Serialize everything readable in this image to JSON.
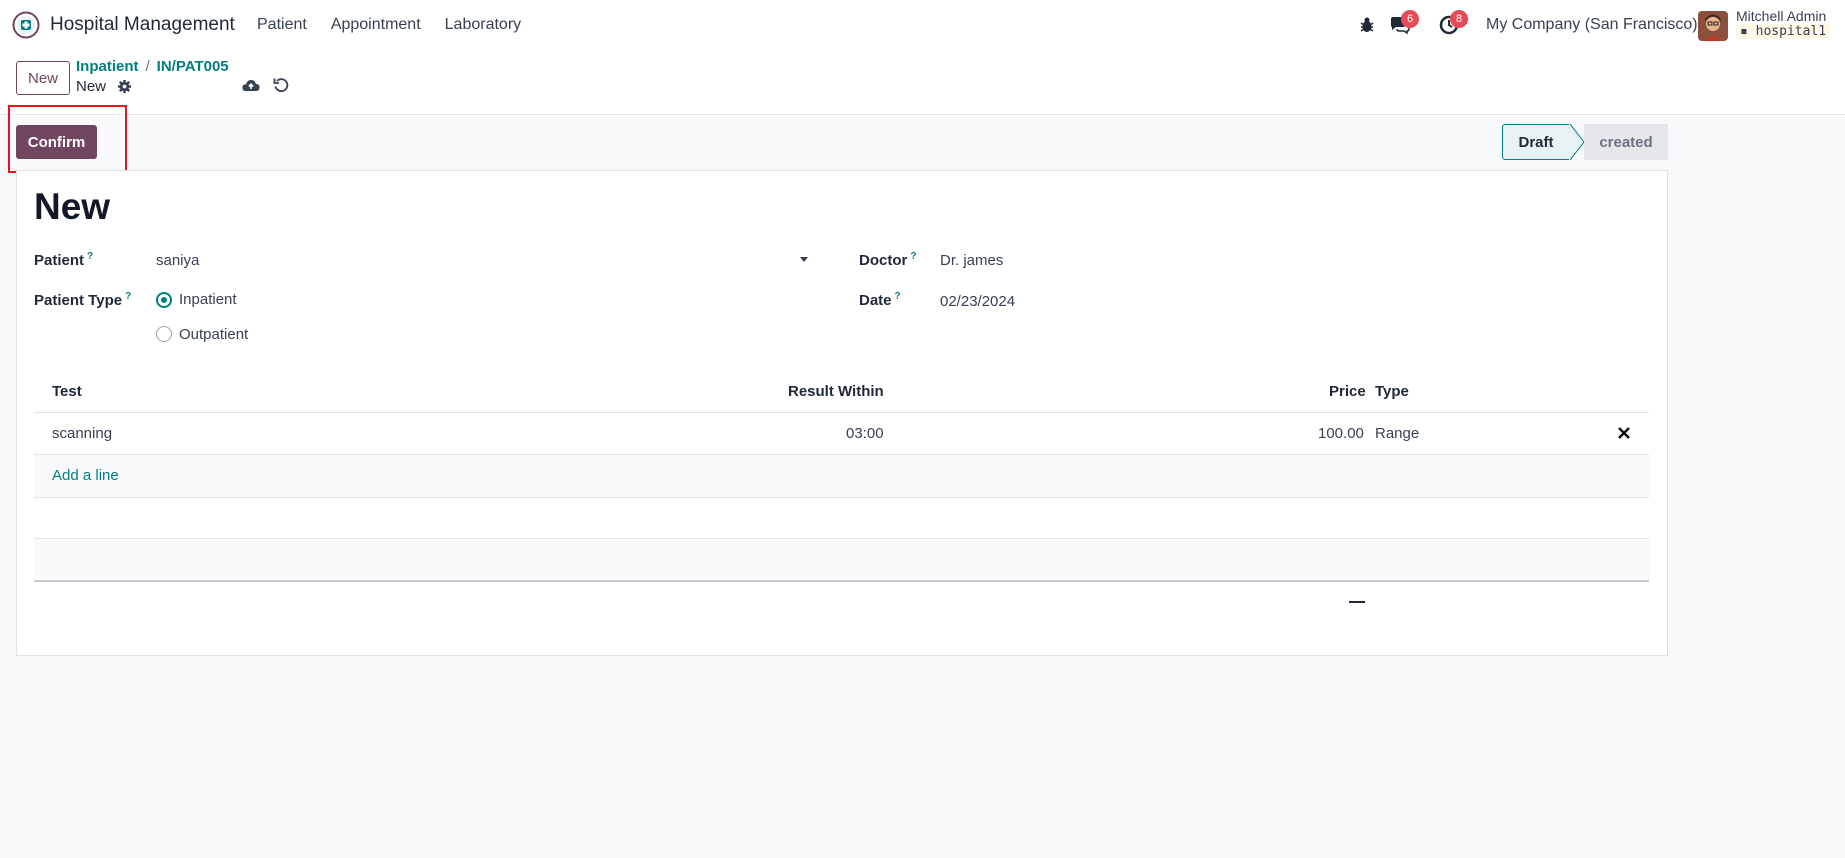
{
  "navbar": {
    "app_name": "Hospital Management",
    "menu": [
      "Patient",
      "Appointment",
      "Laboratory"
    ],
    "messages_count": "6",
    "activities_count": "8",
    "company": "My Company (San Francisco)",
    "user_name": "Mitchell Admin",
    "db_name": "hospital1"
  },
  "control": {
    "new_label": "New",
    "breadcrumb": [
      "Inpatient",
      "IN/PAT005"
    ],
    "current": "New"
  },
  "statusbar": {
    "confirm_label": "Confirm",
    "stages": [
      "Draft",
      "created"
    ],
    "active_stage": "Draft"
  },
  "form": {
    "title": "New",
    "patient_label": "Patient",
    "patient_value": "saniya",
    "patient_type_label": "Patient Type",
    "patient_type_options": [
      "Inpatient",
      "Outpatient"
    ],
    "patient_type_selected": "Inpatient",
    "doctor_label": "Doctor",
    "doctor_value": "Dr. james",
    "date_label": "Date",
    "date_value": "02/23/2024",
    "help_mark": "?"
  },
  "lines": {
    "columns": [
      "Test",
      "Result Within",
      "Price",
      "Type"
    ],
    "rows": [
      {
        "test": "scanning",
        "result_within": "03:00",
        "price": "100.00",
        "type": "Range"
      }
    ],
    "add_line_label": "Add a line"
  },
  "colors": {
    "primary": "#71455f",
    "link": "#017e84",
    "highlight": "#e8141d",
    "badge": "#e64b57"
  }
}
